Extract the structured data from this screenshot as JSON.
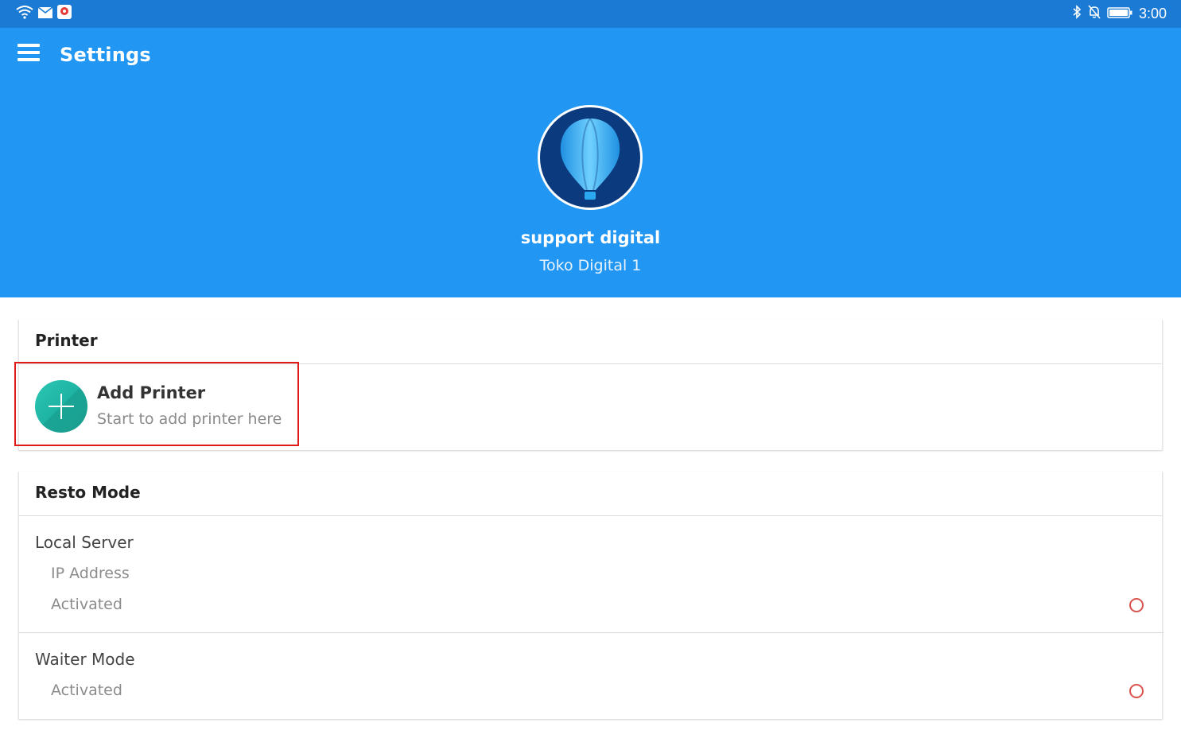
{
  "status_bar": {
    "time": "3:00",
    "left_icons": [
      "wifi-icon",
      "mail-icon",
      "app-notification-icon"
    ],
    "right_icons": [
      "bluetooth-icon",
      "silent-icon",
      "battery-icon"
    ]
  },
  "header": {
    "title": "Settings",
    "profile_name": "support digital",
    "store_name": "Toko Digital 1"
  },
  "printer_section": {
    "title": "Printer",
    "add_printer": {
      "label": "Add Printer",
      "description": "Start to add printer here"
    }
  },
  "resto_section": {
    "title": "Resto Mode",
    "local_server": {
      "label": "Local Server",
      "ip_label": "IP Address",
      "activated_label": "Activated",
      "activated": false
    },
    "waiter_mode": {
      "label": "Waiter Mode",
      "activated_label": "Activated",
      "activated": false
    }
  },
  "colors": {
    "status_bar": "#1b7ad3",
    "header": "#2196f3",
    "add_icon": "#1fb3a3",
    "radio": "#d9534f",
    "highlight": "#e01919"
  }
}
